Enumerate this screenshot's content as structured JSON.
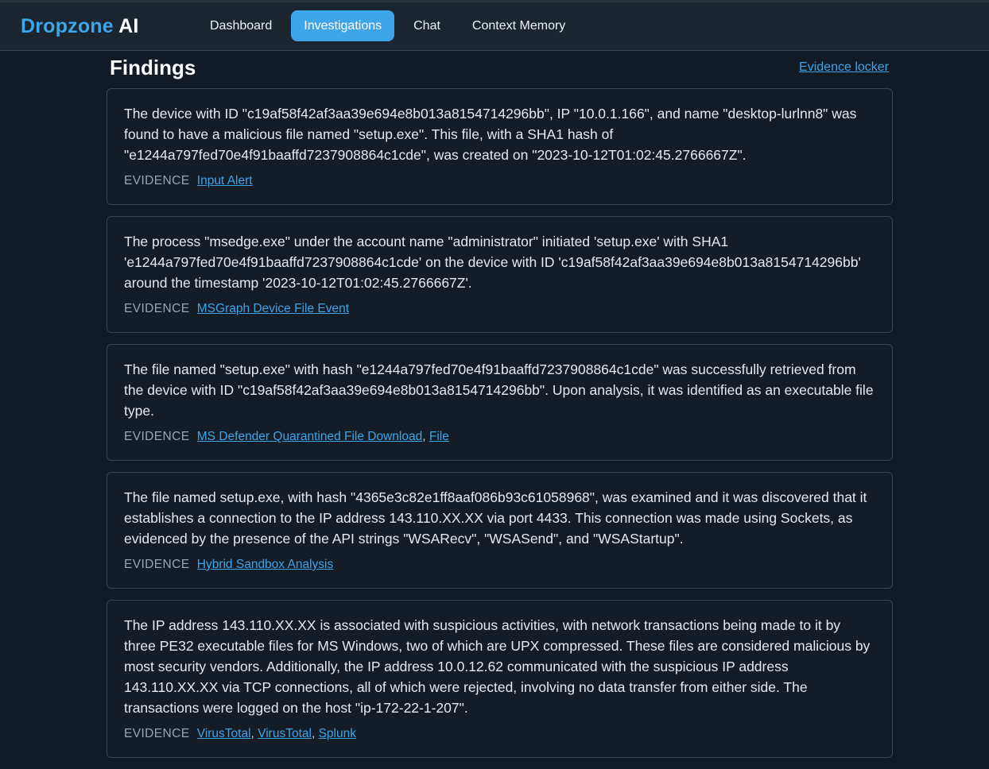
{
  "app": {
    "brand": "Dropzone",
    "brand_suffix": "AI"
  },
  "nav": {
    "items": [
      {
        "label": "Dashboard",
        "active": false
      },
      {
        "label": "Investigations",
        "active": true
      },
      {
        "label": "Chat",
        "active": false
      },
      {
        "label": "Context Memory",
        "active": false
      }
    ]
  },
  "page": {
    "title": "Findings",
    "evidence_locker_link": "Evidence locker"
  },
  "evidence_label": "EVIDENCE",
  "findings": [
    {
      "text": "The device with ID \"c19af58f42af3aa39e694e8b013a8154714296bb\", IP \"10.0.1.166\", and name \"desktop-lurlnn8\" was found to have a malicious file named \"setup.exe\". This file, with a SHA1 hash of \"e1244a797fed70e4f91baaffd7237908864c1cde\", was created on \"2023-10-12T01:02:45.2766667Z\".",
      "evidence": [
        "Input Alert"
      ]
    },
    {
      "text": "The process \"msedge.exe\" under the account name \"administrator\" initiated 'setup.exe' with SHA1 'e1244a797fed70e4f91baaffd7237908864c1cde' on the device with ID 'c19af58f42af3aa39e694e8b013a8154714296bb' around the timestamp '2023-10-12T01:02:45.2766667Z'.",
      "evidence": [
        "MSGraph Device File Event"
      ]
    },
    {
      "text": "The file named \"setup.exe\" with hash \"e1244a797fed70e4f91baaffd7237908864c1cde\" was successfully retrieved from the device with ID \"c19af58f42af3aa39e694e8b013a8154714296bb\". Upon analysis, it was identified as an executable file type.",
      "evidence": [
        "MS Defender Quarantined File Download",
        "File"
      ]
    },
    {
      "text": "The file named setup.exe, with hash \"4365e3c82e1ff8aaf086b93c61058968\", was examined and it was discovered that it establishes a connection to the IP address 143.110.XX.XX via port 4433. This connection was made using Sockets, as evidenced by the presence of the API strings \"WSARecv\", \"WSASend\", and \"WSAStartup\".",
      "evidence": [
        "Hybrid Sandbox Analysis"
      ]
    },
    {
      "text": "The IP address 143.110.XX.XX is associated with suspicious activities, with network transactions being made to it by three PE32 executable files for MS Windows, two of which are UPX compressed. These files are considered malicious by most security vendors. Additionally, the IP address 10.0.12.62 communicated with the suspicious IP address 143.110.XX.XX via TCP connections, all of which were rejected, involving no data transfer from either side. The transactions were logged on the host \"ip-172-22-1-207\".",
      "evidence": [
        "VirusTotal",
        "VirusTotal",
        "Splunk"
      ]
    }
  ]
}
